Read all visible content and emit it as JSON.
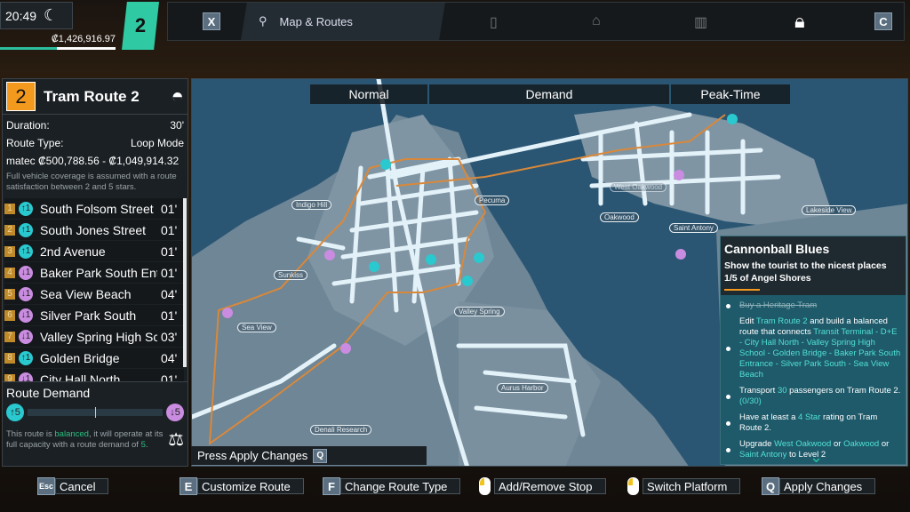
{
  "hud": {
    "time": "20:49",
    "money": "₡1,426,916.97",
    "level": "2",
    "money_progress": 0.5
  },
  "topbar": {
    "left_key": "X",
    "active_tab": "Map & Routes",
    "right_key": "C",
    "icons": [
      "phone-map-icon",
      "garage-icon",
      "buildings-icon",
      "lock-icon"
    ]
  },
  "route": {
    "number": "2",
    "title": "Tram Route 2",
    "duration_label": "Duration:",
    "duration": "30'",
    "type_label": "Route Type:",
    "type": "Loop Mode",
    "cost": "matec ₡500,788.56 - ₡1,049,914.32",
    "note": "Full vehicle coverage is assumed with a route satisfaction between 2 and 5 stars.",
    "stops": [
      {
        "n": "1",
        "dir": "↑1",
        "name": "South Folsom Street",
        "time": "01'",
        "color": "#29c9cf"
      },
      {
        "n": "2",
        "dir": "↑1",
        "name": "South Jones Street",
        "time": "01'",
        "color": "#29c9cf"
      },
      {
        "n": "3",
        "dir": "↑1",
        "name": "2nd Avenue",
        "time": "01'",
        "color": "#29c9cf"
      },
      {
        "n": "4",
        "dir": "↓1",
        "name": "Baker Park South Entrance",
        "time": "01'",
        "color": "#c98ce0"
      },
      {
        "n": "5",
        "dir": "↓1",
        "name": "Sea View Beach",
        "time": "04'",
        "color": "#c98ce0"
      },
      {
        "n": "6",
        "dir": "↓1",
        "name": "Silver Park South",
        "time": "01'",
        "color": "#c98ce0"
      },
      {
        "n": "7",
        "dir": "↓1",
        "name": "Valley Spring High School",
        "time": "03'",
        "color": "#c98ce0"
      },
      {
        "n": "8",
        "dir": "↑1",
        "name": "Golden Bridge",
        "time": "04'",
        "color": "#29c9cf"
      },
      {
        "n": "9",
        "dir": "↓1",
        "name": "City Hall North",
        "time": "01'",
        "color": "#c98ce0"
      }
    ],
    "demand_title": "Route Demand",
    "demand_up": "↑5",
    "demand_down": "↓5",
    "demand_text_1": "This route is ",
    "demand_word": "balanced",
    "demand_text_2": ", it will operate at its full capacity with a route demand of ",
    "demand_value": "5",
    "demand_text_3": "."
  },
  "map": {
    "tabs": [
      "Normal",
      "Demand",
      "Peak-Time"
    ],
    "labels": [
      "Indigo Hill",
      "Pecuma",
      "Oakwood",
      "Saint Antony",
      "Lakeside View",
      "Sunkiss",
      "Valley Spring",
      "Sea View",
      "Aurus Harbor",
      "Denali Research",
      "West Oakwood"
    ],
    "apply_hint": "Press Apply Changes",
    "apply_key": "Q",
    "colors": {
      "water": "#2b5673",
      "land": "#7f95a4",
      "road": "#e3f1f8",
      "route": "#d9883a",
      "stop_up": "#29c9cf",
      "stop_down": "#c98ce0"
    }
  },
  "quest": {
    "title": "Cannonball Blues",
    "subtitle": "Show the tourist to the nicest places 1/5 of Angel Shores",
    "done": "Buy a Heritage Tram",
    "t2a": "Edit ",
    "t2b": "Tram Route 2",
    "t2c": " and build a balanced route that connects ",
    "t2d": "Transit Terminal - D+E - City Hall North - Valley Spring High School - Golden Bridge - Baker Park South Entrance - Silver Park South - Sea View Beach",
    "t3a": "Transport ",
    "t3b": "30",
    "t3c": " passengers on Tram Route 2. ",
    "t3d": "(0/30)",
    "t4a": "Have at least a ",
    "t4b": "4 Star",
    "t4c": " rating on  Tram Route 2.",
    "t5a": "Upgrade ",
    "t5b": "West Oakwood",
    "t5c": " or ",
    "t5d": "Oakwood",
    "t5e": " or ",
    "t5f": "Saint Antony",
    "t5g": " to Level 2"
  },
  "bottom": [
    {
      "key": "Esc",
      "label": "Cancel"
    },
    {
      "key": "E",
      "label": "Customize Route"
    },
    {
      "key": "F",
      "label": "Change Route Type"
    },
    {
      "key": "mouse-left",
      "label": "Add/Remove Stop"
    },
    {
      "key": "mouse-left",
      "label": "Switch Platform"
    },
    {
      "key": "Q",
      "label": "Apply Changes"
    }
  ]
}
